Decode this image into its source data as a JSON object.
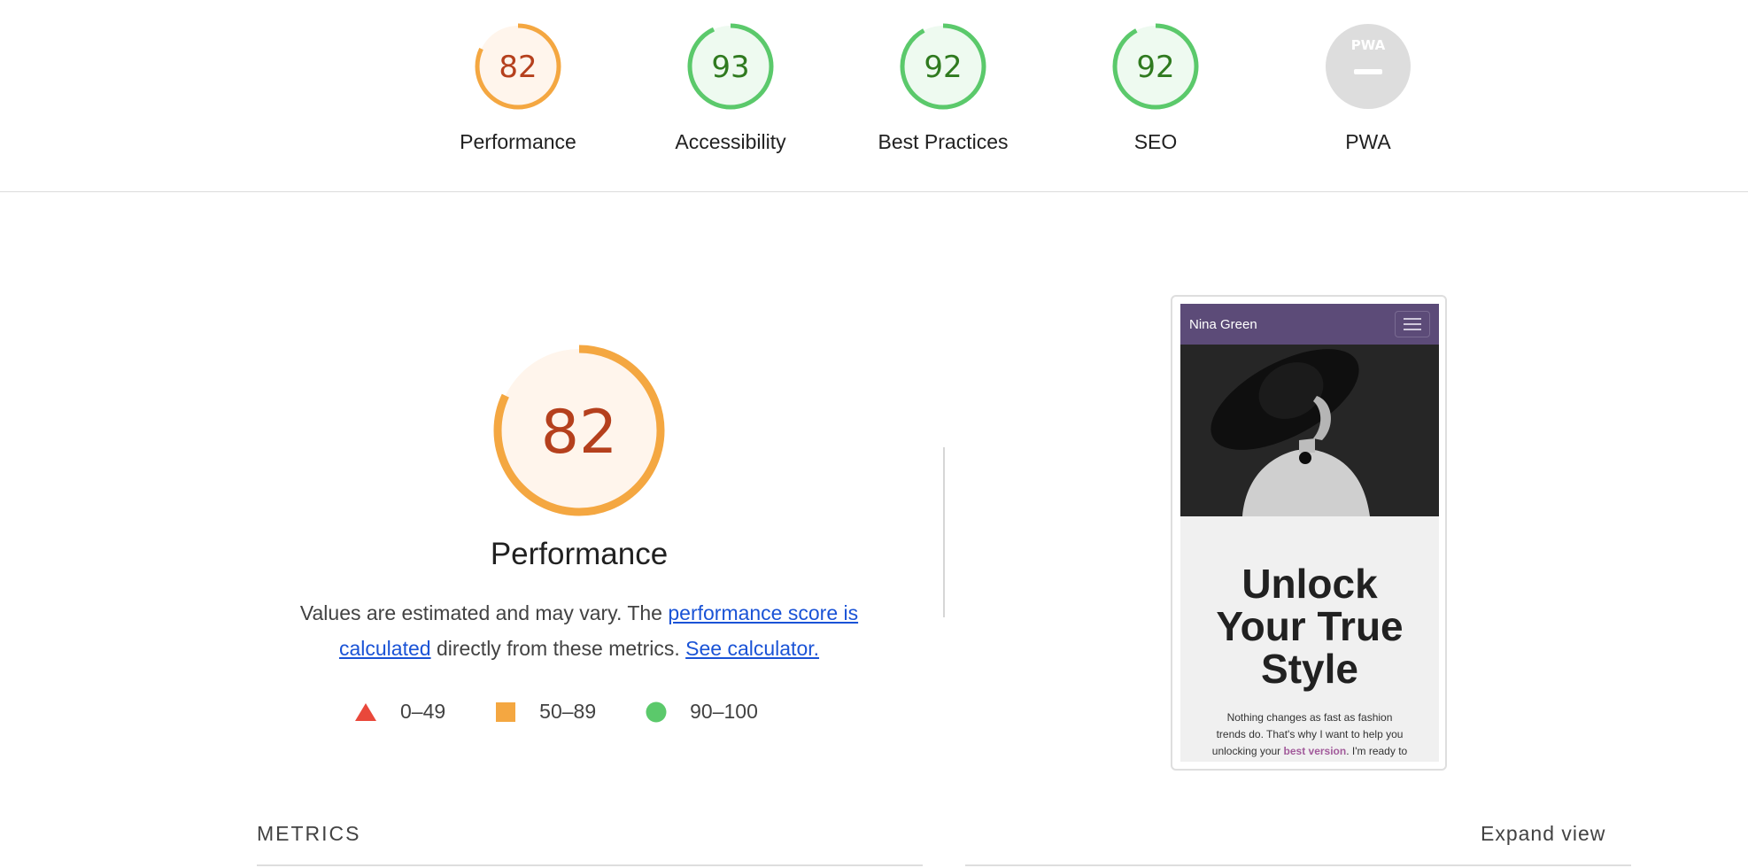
{
  "categories": [
    {
      "label": "Performance",
      "score": "82",
      "status": "average"
    },
    {
      "label": "Accessibility",
      "score": "93",
      "status": "pass"
    },
    {
      "label": "Best Practices",
      "score": "92",
      "status": "pass"
    },
    {
      "label": "SEO",
      "score": "92",
      "status": "pass"
    },
    {
      "label": "PWA",
      "score": "",
      "badge_text": "PWA",
      "status": "na"
    }
  ],
  "performance": {
    "score": "82",
    "title": "Performance",
    "desc_prefix": "Values are estimated and may vary. The ",
    "desc_link1": "performance score is calculated",
    "desc_middle": " directly from these metrics. ",
    "desc_link2": "See calculator."
  },
  "legend": [
    {
      "range": "0–49",
      "shape": "triangle",
      "color": "#e9483b"
    },
    {
      "range": "50–89",
      "shape": "square",
      "color": "#f4a741"
    },
    {
      "range": "90–100",
      "shape": "circle",
      "color": "#5bc96b"
    }
  ],
  "screenshot": {
    "brand": "Nina Green",
    "heading_lines": [
      "Unlock",
      "Your True",
      "Style"
    ],
    "body_lines": [
      "Nothing changes as fast as fashion",
      "trends do. That's why I want to help you"
    ],
    "body_line3_prefix": "unlocking your ",
    "body_line3_highlight": "best version",
    "body_line3_suffix": ". I'm ready to"
  },
  "metrics": {
    "title": "METRICS",
    "expand_label": "Expand view"
  },
  "colors": {
    "average_ring": "#f4a741",
    "average_text": "#b5401d",
    "average_fill": "#fff5ec",
    "pass_ring": "#5bc96b",
    "pass_text": "#2f7a1f",
    "pass_fill": "#eefaf0",
    "na_fill": "#dddddd",
    "link": "#1a53d6",
    "nav_bg": "#5c4b78"
  }
}
